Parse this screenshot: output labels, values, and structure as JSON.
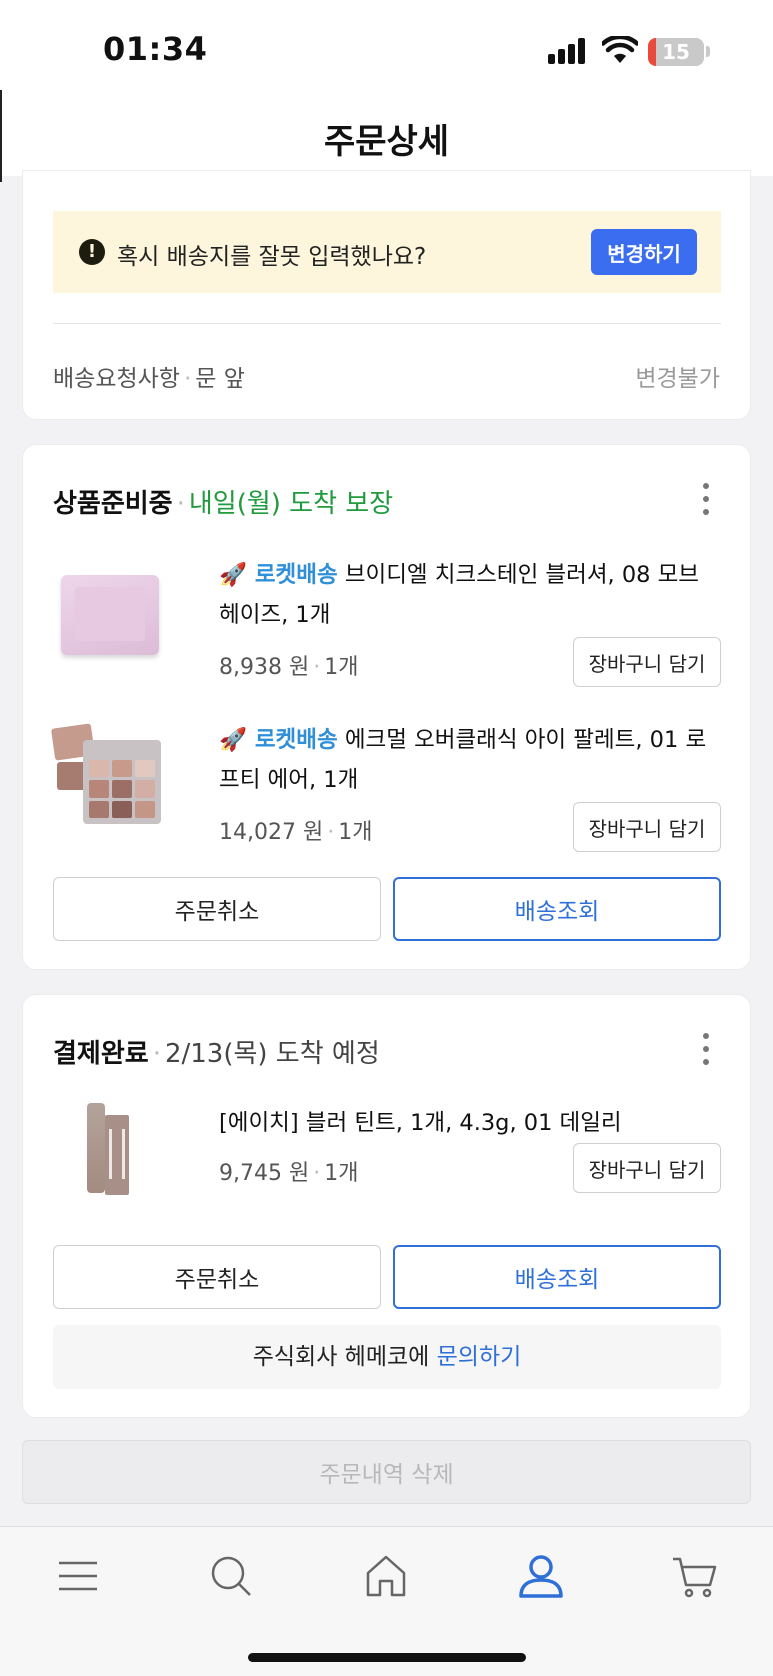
{
  "status_bar": {
    "time": "01:34",
    "battery": "15",
    "battery_level": 0.15
  },
  "header": {
    "title": "주문상세"
  },
  "address_card": {
    "warning_text": "혹시 배송지를 잘못 입력했나요?",
    "warning_icon": "exclamation-icon",
    "change_button": "변경하기",
    "request_label": "배송요청사항",
    "request_value": "문 앞",
    "request_status": "변경불가"
  },
  "shipments": [
    {
      "status": "상품준비중",
      "status_detail": "내일(월) 도착 보장",
      "status_color": "#1f9a3c",
      "products": [
        {
          "badge": "🚀 로켓배송",
          "name": "브이디엘 치크스테인 블러셔, 08 모브 헤이즈, 1개",
          "price": "8,938 원",
          "qty": "1개",
          "cart_button": "장바구니 담기"
        },
        {
          "badge": "🚀 로켓배송",
          "name": "에크멀 오버클래식 아이 팔레트, 01 로프티 에어, 1개",
          "price": "14,027 원",
          "qty": "1개",
          "cart_button": "장바구니 담기"
        }
      ],
      "cancel_button": "주문취소",
      "track_button": "배송조회"
    },
    {
      "status": "결제완료",
      "status_detail": "2/13(목) 도착 예정",
      "status_color": "#444444",
      "products": [
        {
          "badge": "",
          "name": "[에이치] 블러 틴트, 1개, 4.3g, 01 데일리",
          "price": "9,745 원",
          "qty": "1개",
          "cart_button": "장바구니 담기"
        }
      ],
      "cancel_button": "주문취소",
      "track_button": "배송조회",
      "inquiry_company": "주식회사 헤메코에",
      "inquiry_link": "문의하기"
    }
  ],
  "delete_button": "주문내역 삭제",
  "tabbar": {
    "items": [
      {
        "icon": "menu-icon",
        "active": false
      },
      {
        "icon": "search-icon",
        "active": false
      },
      {
        "icon": "home-icon",
        "active": false
      },
      {
        "icon": "profile-icon",
        "active": true
      },
      {
        "icon": "cart-icon",
        "active": false
      }
    ]
  },
  "colors": {
    "accent_blue": "#2f6fd8",
    "change_button_blue": "#3a6df0",
    "warning_bg": "#fdf6dc",
    "rocket_blue": "#2f8fd8"
  }
}
